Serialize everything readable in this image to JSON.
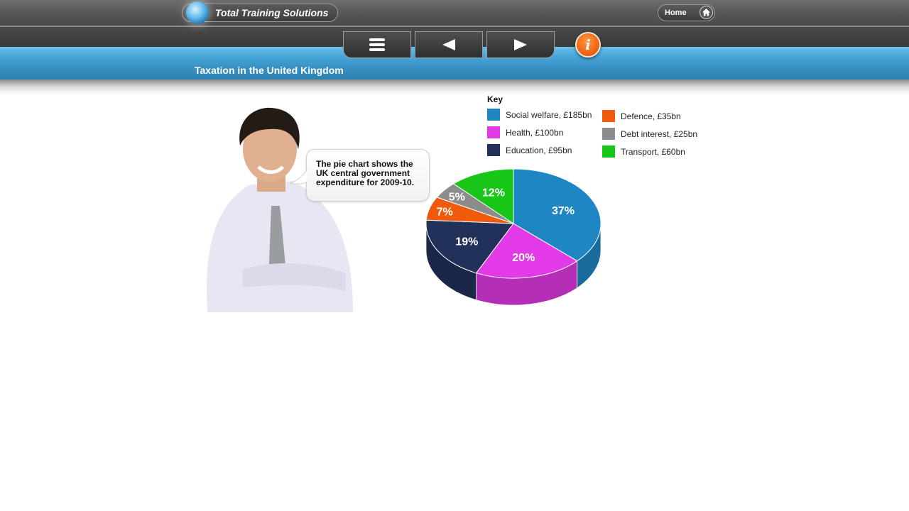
{
  "header": {
    "brand": "Total Training Solutions",
    "home_label": "Home"
  },
  "nav": {
    "menu_icon": "hamburger-icon",
    "prev_icon": "arrow-left-icon",
    "next_icon": "arrow-right-icon",
    "info_icon": "info-icon",
    "info_glyph": "i"
  },
  "page": {
    "title": "Taxation in the United Kingdom"
  },
  "speech_bubble": {
    "text": "The pie chart shows the UK central government expenditure for 2009-10."
  },
  "colors": {
    "accent_blue": "#3a93c5",
    "info_orange": "#ee6010"
  },
  "chart_data": {
    "type": "pie",
    "style": "3d",
    "title": "UK central government expenditure 2009-10",
    "legend_title": "Key",
    "legend_position": "top-right",
    "slices": [
      {
        "key": "social_welfare",
        "label": "Social welfare, £185bn",
        "name": "Social welfare",
        "value_bn": 185,
        "percent_label": "37%",
        "color": "#1f86c4"
      },
      {
        "key": "health",
        "label": "Health, £100bn",
        "name": "Health",
        "value_bn": 100,
        "percent_label": "20%",
        "color": "#e23ae6"
      },
      {
        "key": "education",
        "label": "Education, £95bn",
        "name": "Education",
        "value_bn": 95,
        "percent_label": "19%",
        "color": "#22315a"
      },
      {
        "key": "defence",
        "label": "Defence, £35bn",
        "name": "Defence",
        "value_bn": 35,
        "percent_label": "7%",
        "color": "#ef5a0c"
      },
      {
        "key": "debt_interest",
        "label": "Debt interest, £25bn",
        "name": "Debt interest",
        "value_bn": 25,
        "percent_label": "5%",
        "color": "#8c8c8c"
      },
      {
        "key": "transport",
        "label": "Transport, £60bn",
        "name": "Transport",
        "value_bn": 60,
        "percent_label": "12%",
        "color": "#18c618"
      }
    ]
  }
}
